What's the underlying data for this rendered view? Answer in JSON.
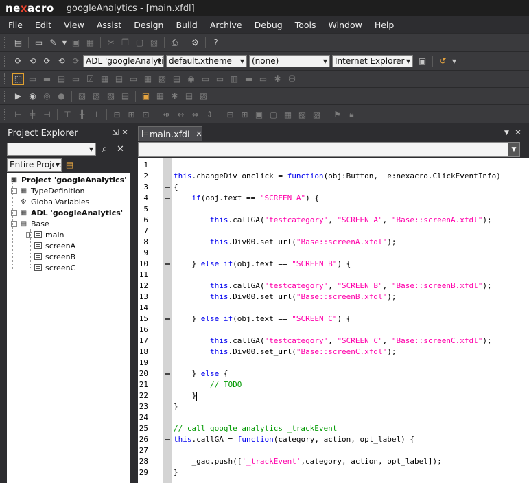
{
  "app": {
    "logo_pre": "ne",
    "logo_x": "x",
    "logo_post": "acro",
    "title": "googleAnalytics - [main.xfdl]"
  },
  "menu": [
    "File",
    "Edit",
    "View",
    "Assist",
    "Design",
    "Build",
    "Archive",
    "Debug",
    "Tools",
    "Window",
    "Help"
  ],
  "toolbar2": {
    "adl_combo": "ADL 'googleAnalyti",
    "theme_combo": "default.xtheme",
    "none_combo": "(none)",
    "browser_combo": "Internet Explorer"
  },
  "project_explorer": {
    "title": "Project Explorer",
    "pin": "⇲",
    "close": "✕",
    "filter": "Entire Projec",
    "tree": [
      {
        "label": "Project 'googleAnalytics'",
        "bold": true,
        "level": 0,
        "expander": ""
      },
      {
        "label": "TypeDefinition",
        "bold": false,
        "level": 1,
        "expander": "+"
      },
      {
        "label": "GlobalVariables",
        "bold": false,
        "level": 1,
        "expander": ""
      },
      {
        "label": "ADL 'googleAnalytics'",
        "bold": true,
        "level": 1,
        "expander": "+"
      },
      {
        "label": "Base",
        "bold": false,
        "level": 1,
        "expander": "−"
      },
      {
        "label": "main",
        "bold": false,
        "level": 2,
        "expander": "+"
      },
      {
        "label": "screenA",
        "bold": false,
        "level": 2,
        "expander": ""
      },
      {
        "label": "screenB",
        "bold": false,
        "level": 2,
        "expander": ""
      },
      {
        "label": "screenC",
        "bold": false,
        "level": 2,
        "expander": ""
      }
    ]
  },
  "editor": {
    "tab_label": "main.xfdl",
    "tab_close": "✕",
    "lines": [
      {
        "n": "1",
        "fold": false,
        "t": []
      },
      {
        "n": "2",
        "fold": false,
        "t": [
          [
            "kw",
            "this"
          ],
          [
            "",
            "."
          ],
          [
            "",
            "changeDiv_onclick = "
          ],
          [
            "kw",
            "function"
          ],
          [
            "",
            "(obj:Button,  e:nexacro.ClickEventInfo)"
          ]
        ]
      },
      {
        "n": "3",
        "fold": true,
        "t": [
          [
            "",
            "{"
          ]
        ]
      },
      {
        "n": "4",
        "fold": true,
        "t": [
          [
            "",
            "    "
          ],
          [
            "kw",
            "if"
          ],
          [
            "",
            "(obj.text == "
          ],
          [
            "str",
            "\"SCREEN A\""
          ],
          [
            "",
            ") {"
          ]
        ]
      },
      {
        "n": "5",
        "fold": false,
        "t": []
      },
      {
        "n": "6",
        "fold": false,
        "t": [
          [
            "",
            "        "
          ],
          [
            "kw",
            "this"
          ],
          [
            "",
            ".callGA("
          ],
          [
            "str",
            "\"testcategory\""
          ],
          [
            "",
            ", "
          ],
          [
            "str",
            "\"SCREEN A\""
          ],
          [
            "",
            ", "
          ],
          [
            "str",
            "\"Base::screenA.xfdl\""
          ],
          [
            "",
            ");"
          ]
        ]
      },
      {
        "n": "7",
        "fold": false,
        "t": []
      },
      {
        "n": "8",
        "fold": false,
        "t": [
          [
            "",
            "        "
          ],
          [
            "kw",
            "this"
          ],
          [
            "",
            ".Div00.set_url("
          ],
          [
            "str",
            "\"Base::screenA.xfdl\""
          ],
          [
            "",
            ");"
          ]
        ]
      },
      {
        "n": "9",
        "fold": false,
        "t": []
      },
      {
        "n": "10",
        "fold": true,
        "t": [
          [
            "",
            "    } "
          ],
          [
            "kw",
            "else if"
          ],
          [
            "",
            "(obj.text == "
          ],
          [
            "str",
            "\"SCREEN B\""
          ],
          [
            "",
            ") {"
          ]
        ]
      },
      {
        "n": "11",
        "fold": false,
        "t": []
      },
      {
        "n": "12",
        "fold": false,
        "t": [
          [
            "",
            "        "
          ],
          [
            "kw",
            "this"
          ],
          [
            "",
            ".callGA("
          ],
          [
            "str",
            "\"testcategory\""
          ],
          [
            "",
            ", "
          ],
          [
            "str",
            "\"SCREEN B\""
          ],
          [
            "",
            ", "
          ],
          [
            "str",
            "\"Base::screenB.xfdl\""
          ],
          [
            "",
            ");"
          ]
        ]
      },
      {
        "n": "13",
        "fold": false,
        "t": [
          [
            "",
            "        "
          ],
          [
            "kw",
            "this"
          ],
          [
            "",
            ".Div00.set_url("
          ],
          [
            "str",
            "\"Base::screenB.xfdl\""
          ],
          [
            "",
            ");"
          ]
        ]
      },
      {
        "n": "14",
        "fold": false,
        "t": []
      },
      {
        "n": "15",
        "fold": true,
        "t": [
          [
            "",
            "    } "
          ],
          [
            "kw",
            "else if"
          ],
          [
            "",
            "(obj.text == "
          ],
          [
            "str",
            "\"SCREEN C\""
          ],
          [
            "",
            ") {"
          ]
        ]
      },
      {
        "n": "16",
        "fold": false,
        "t": []
      },
      {
        "n": "17",
        "fold": false,
        "t": [
          [
            "",
            "        "
          ],
          [
            "kw",
            "this"
          ],
          [
            "",
            ".callGA("
          ],
          [
            "str",
            "\"testcategory\""
          ],
          [
            "",
            ", "
          ],
          [
            "str",
            "\"SCREEN C\""
          ],
          [
            "",
            ", "
          ],
          [
            "str",
            "\"Base::screenC.xfdl\""
          ],
          [
            "",
            ");"
          ]
        ]
      },
      {
        "n": "18",
        "fold": false,
        "t": [
          [
            "",
            "        "
          ],
          [
            "kw",
            "this"
          ],
          [
            "",
            ".Div00.set_url("
          ],
          [
            "str",
            "\"Base::screenC.xfdl\""
          ],
          [
            "",
            ");"
          ]
        ]
      },
      {
        "n": "19",
        "fold": false,
        "t": []
      },
      {
        "n": "20",
        "fold": true,
        "t": [
          [
            "",
            "    } "
          ],
          [
            "kw",
            "else"
          ],
          [
            "",
            " {"
          ]
        ]
      },
      {
        "n": "21",
        "fold": false,
        "t": [
          [
            "",
            "        "
          ],
          [
            "cmt",
            "// TODO"
          ]
        ]
      },
      {
        "n": "22",
        "fold": false,
        "t": [
          [
            "",
            "    }"
          ]
        ],
        "cursor": true
      },
      {
        "n": "23",
        "fold": false,
        "t": [
          [
            "",
            "}"
          ]
        ]
      },
      {
        "n": "24",
        "fold": false,
        "t": []
      },
      {
        "n": "25",
        "fold": false,
        "t": [
          [
            "cmt",
            "// call google analytics _trackEvent"
          ]
        ]
      },
      {
        "n": "26",
        "fold": true,
        "t": [
          [
            "kw",
            "this"
          ],
          [
            "",
            ".callGA = "
          ],
          [
            "kw",
            "function"
          ],
          [
            "",
            "(category, action, opt_label) {"
          ]
        ]
      },
      {
        "n": "27",
        "fold": false,
        "t": []
      },
      {
        "n": "28",
        "fold": false,
        "t": [
          [
            "",
            "    _gaq.push(["
          ],
          [
            "str",
            "'_trackEvent'"
          ],
          [
            "",
            ",category, action, opt_label]);"
          ]
        ]
      },
      {
        "n": "29",
        "fold": false,
        "t": [
          [
            "",
            "}"
          ]
        ]
      }
    ]
  }
}
